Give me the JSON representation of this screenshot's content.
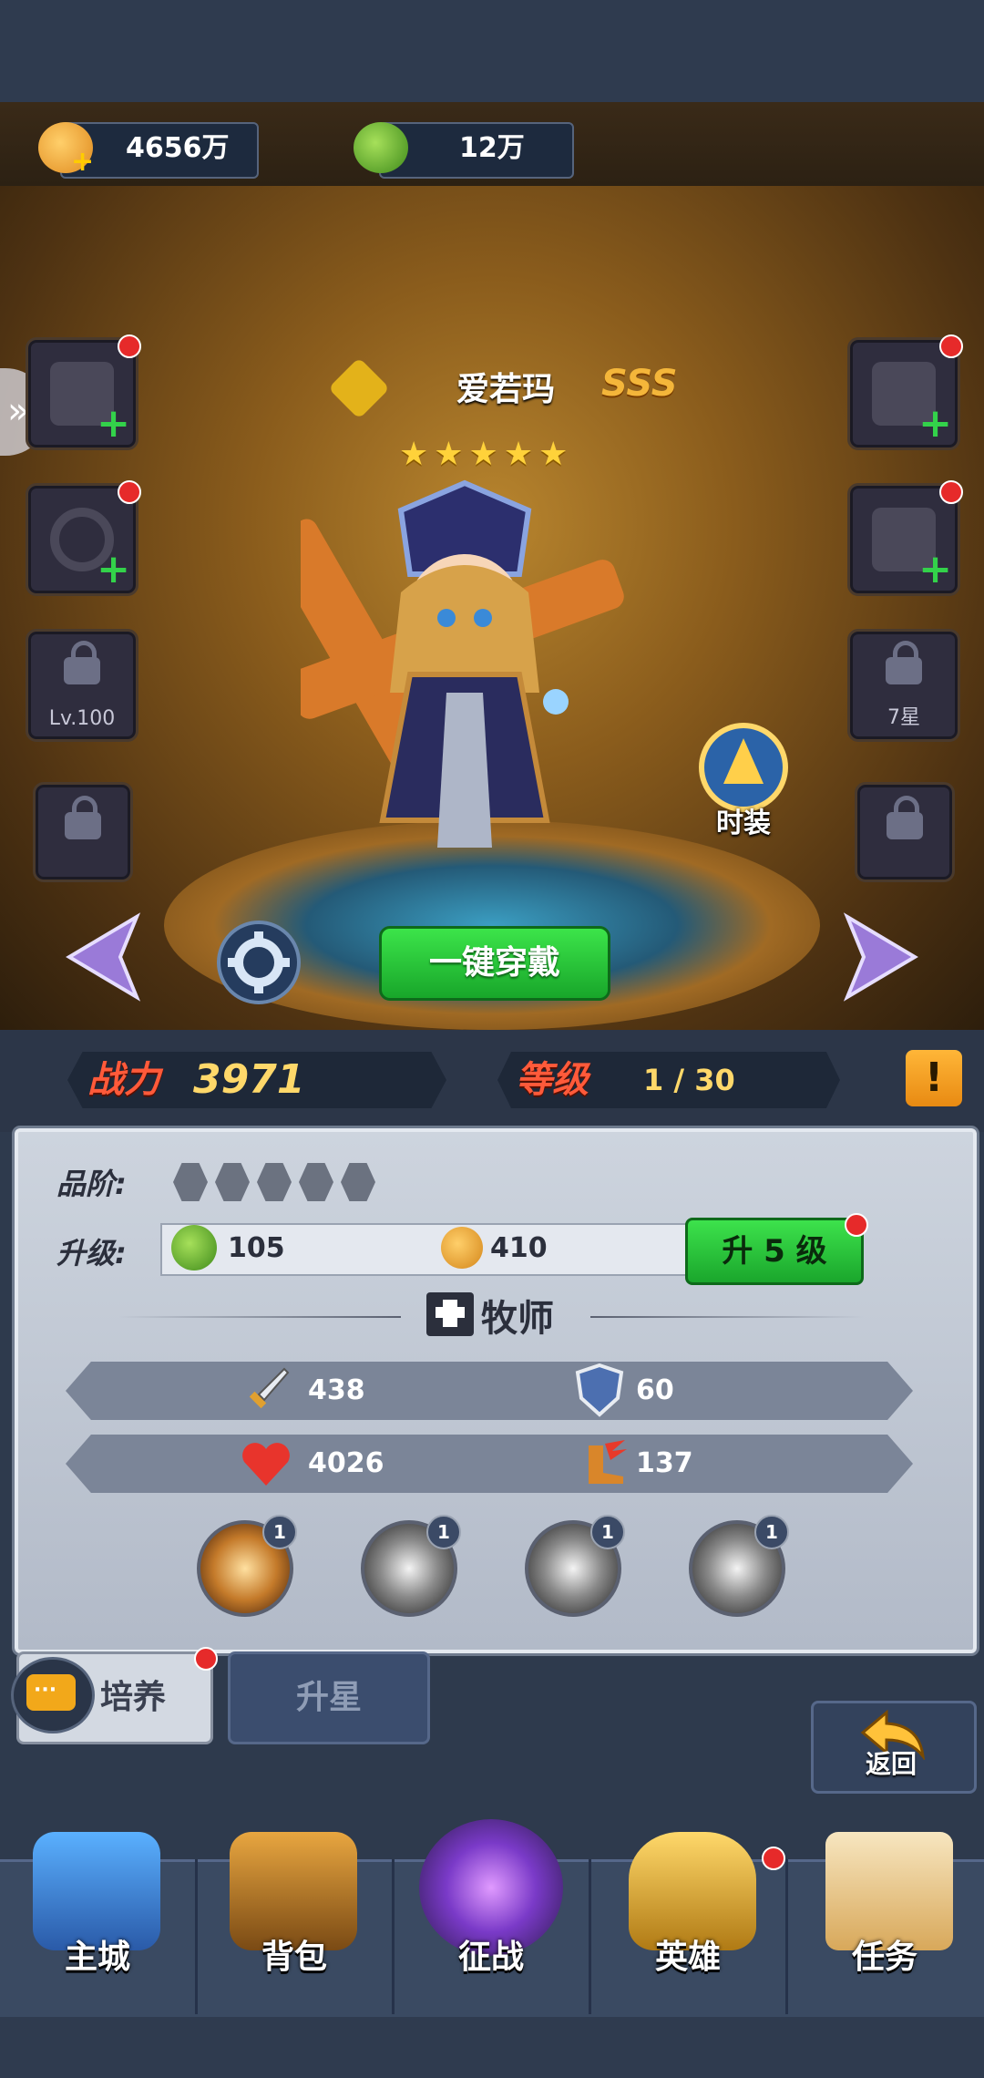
{
  "resources": {
    "gold": {
      "icon": "gold-coin-plus-icon",
      "value": "4656万"
    },
    "exp": {
      "icon": "green-exp-potion-icon",
      "value": "12万"
    }
  },
  "hero": {
    "name": "爱若玛",
    "rank_icon": "hexagon-emblem-icon",
    "grade": "SSS",
    "stars": "★★★★★",
    "star_count": 5
  },
  "equipment_slots": {
    "left": [
      {
        "icon": "weapon-slot-icon",
        "state": "add"
      },
      {
        "icon": "ring-slot-icon",
        "state": "add"
      },
      {
        "icon": "lock-icon",
        "state": "locked",
        "label": "Lv.100"
      },
      {
        "icon": "lock-icon",
        "state": "locked"
      }
    ],
    "right": [
      {
        "icon": "armor-slot-icon",
        "state": "add"
      },
      {
        "icon": "boots-slot-icon",
        "state": "add"
      },
      {
        "icon": "lock-icon",
        "state": "locked",
        "label": "7星"
      },
      {
        "icon": "lock-icon",
        "state": "locked"
      }
    ]
  },
  "costume": {
    "icon": "costume-icon",
    "label": "时装"
  },
  "equip_all_button": "一键穿戴",
  "stats": {
    "power_label": "战力",
    "power_value": "3971",
    "level_label": "等级",
    "level_value": "1 / 30"
  },
  "details": {
    "quality_label": "品阶:",
    "quality_filled": 0,
    "quality_total": 5,
    "upgrade_label": "升级:",
    "upgrade_cost_exp": "105",
    "upgrade_cost_gold": "410",
    "upgrade_button": "升 5 级",
    "class_name": "牧师",
    "class_icon": "priest-book-icon",
    "attributes": [
      {
        "icon": "sword-icon",
        "value": "438"
      },
      {
        "icon": "shield-icon",
        "value": "60"
      },
      {
        "icon": "heart-icon",
        "value": "4026"
      },
      {
        "icon": "winged-boot-icon",
        "value": "137"
      }
    ],
    "skills": [
      {
        "level": "1"
      },
      {
        "level": "1"
      },
      {
        "level": "1"
      },
      {
        "level": "1"
      }
    ]
  },
  "tabs": [
    {
      "label": "培养",
      "active": true
    },
    {
      "label": "升星",
      "active": false
    }
  ],
  "return_button": "返回",
  "nav": [
    {
      "label": "主城",
      "icon": "castle-icon"
    },
    {
      "label": "背包",
      "icon": "treasure-chest-icon"
    },
    {
      "label": "征战",
      "icon": "dragon-portal-icon"
    },
    {
      "label": "英雄",
      "icon": "golden-helmet-icon"
    },
    {
      "label": "任务",
      "icon": "scroll-icon"
    }
  ],
  "colors": {
    "accent_green": "#2cc63c",
    "power_red": "#ff5a3a",
    "value_gold": "#ffd86a",
    "panel_bg": "#c3cad6"
  }
}
